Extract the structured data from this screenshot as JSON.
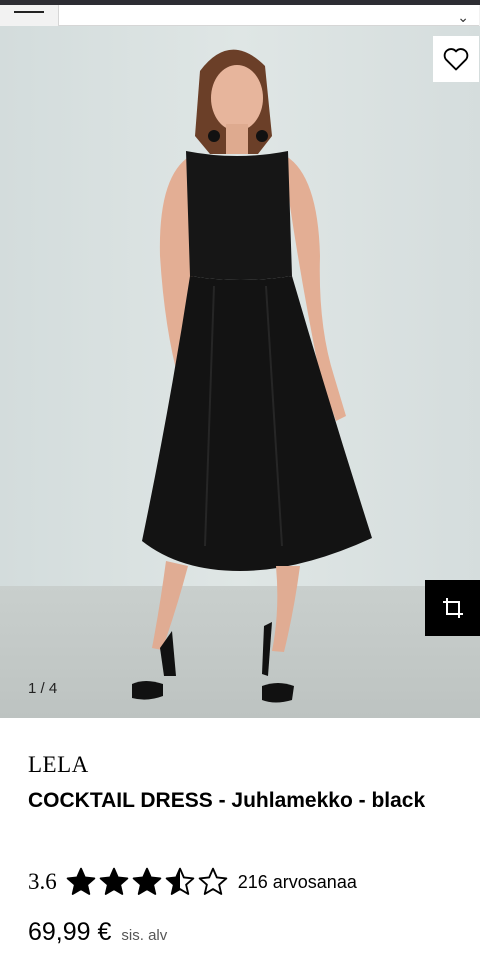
{
  "header": {
    "menu_icon": "hamburger-icon",
    "close_icon": "close-icon"
  },
  "gallery": {
    "counter": "1 / 4",
    "favorite_icon": "heart-outline-icon",
    "fit_icon": "crop-icon"
  },
  "product": {
    "brand": "LELA",
    "name": "COCKTAIL DRESS - Juhlamekko - black",
    "rating_value": "3.6",
    "rating_stars": 3.6,
    "rating_max": 5,
    "rating_count": "216 arvosanaa",
    "price": "69,99 €",
    "vat_note": "sis. alv"
  }
}
